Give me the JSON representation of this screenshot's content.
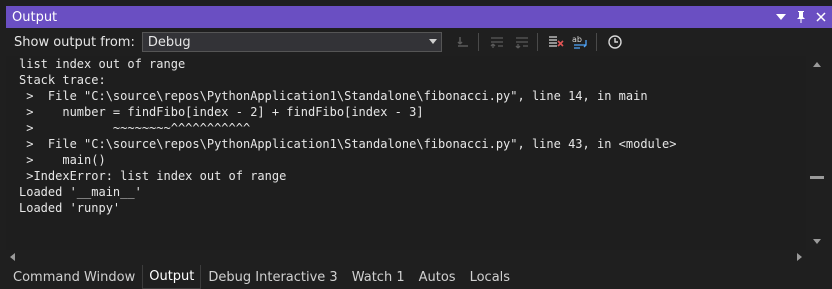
{
  "title": "Output",
  "title_buttons": {
    "dropdown": "▾",
    "pin": "📌",
    "close": "✕"
  },
  "toolbar": {
    "show_output_label": "Show output from:",
    "source_selected": "Debug"
  },
  "output_lines": [
    "list index out of range",
    "Stack trace:",
    " >  File \"C:\\source\\repos\\PythonApplication1\\Standalone\\fibonacci.py\", line 14, in main",
    " >    number = findFibo[index - 2] + findFibo[index - 3]",
    " >           ~~~~~~~~^^^^^^^^^^^",
    " >  File \"C:\\source\\repos\\PythonApplication1\\Standalone\\fibonacci.py\", line 43, in <module>",
    " >    main()",
    " >IndexError: list index out of range",
    "Loaded '__main__'",
    "Loaded 'runpy'"
  ],
  "tabs": [
    {
      "label": "Command Window",
      "active": false
    },
    {
      "label": "Output",
      "active": true
    },
    {
      "label": "Debug Interactive 3",
      "active": false
    },
    {
      "label": "Watch 1",
      "active": false
    },
    {
      "label": "Autos",
      "active": false
    },
    {
      "label": "Locals",
      "active": false
    }
  ],
  "colors": {
    "title_bar": "#6a4fc2",
    "background": "#1f1f1f"
  }
}
